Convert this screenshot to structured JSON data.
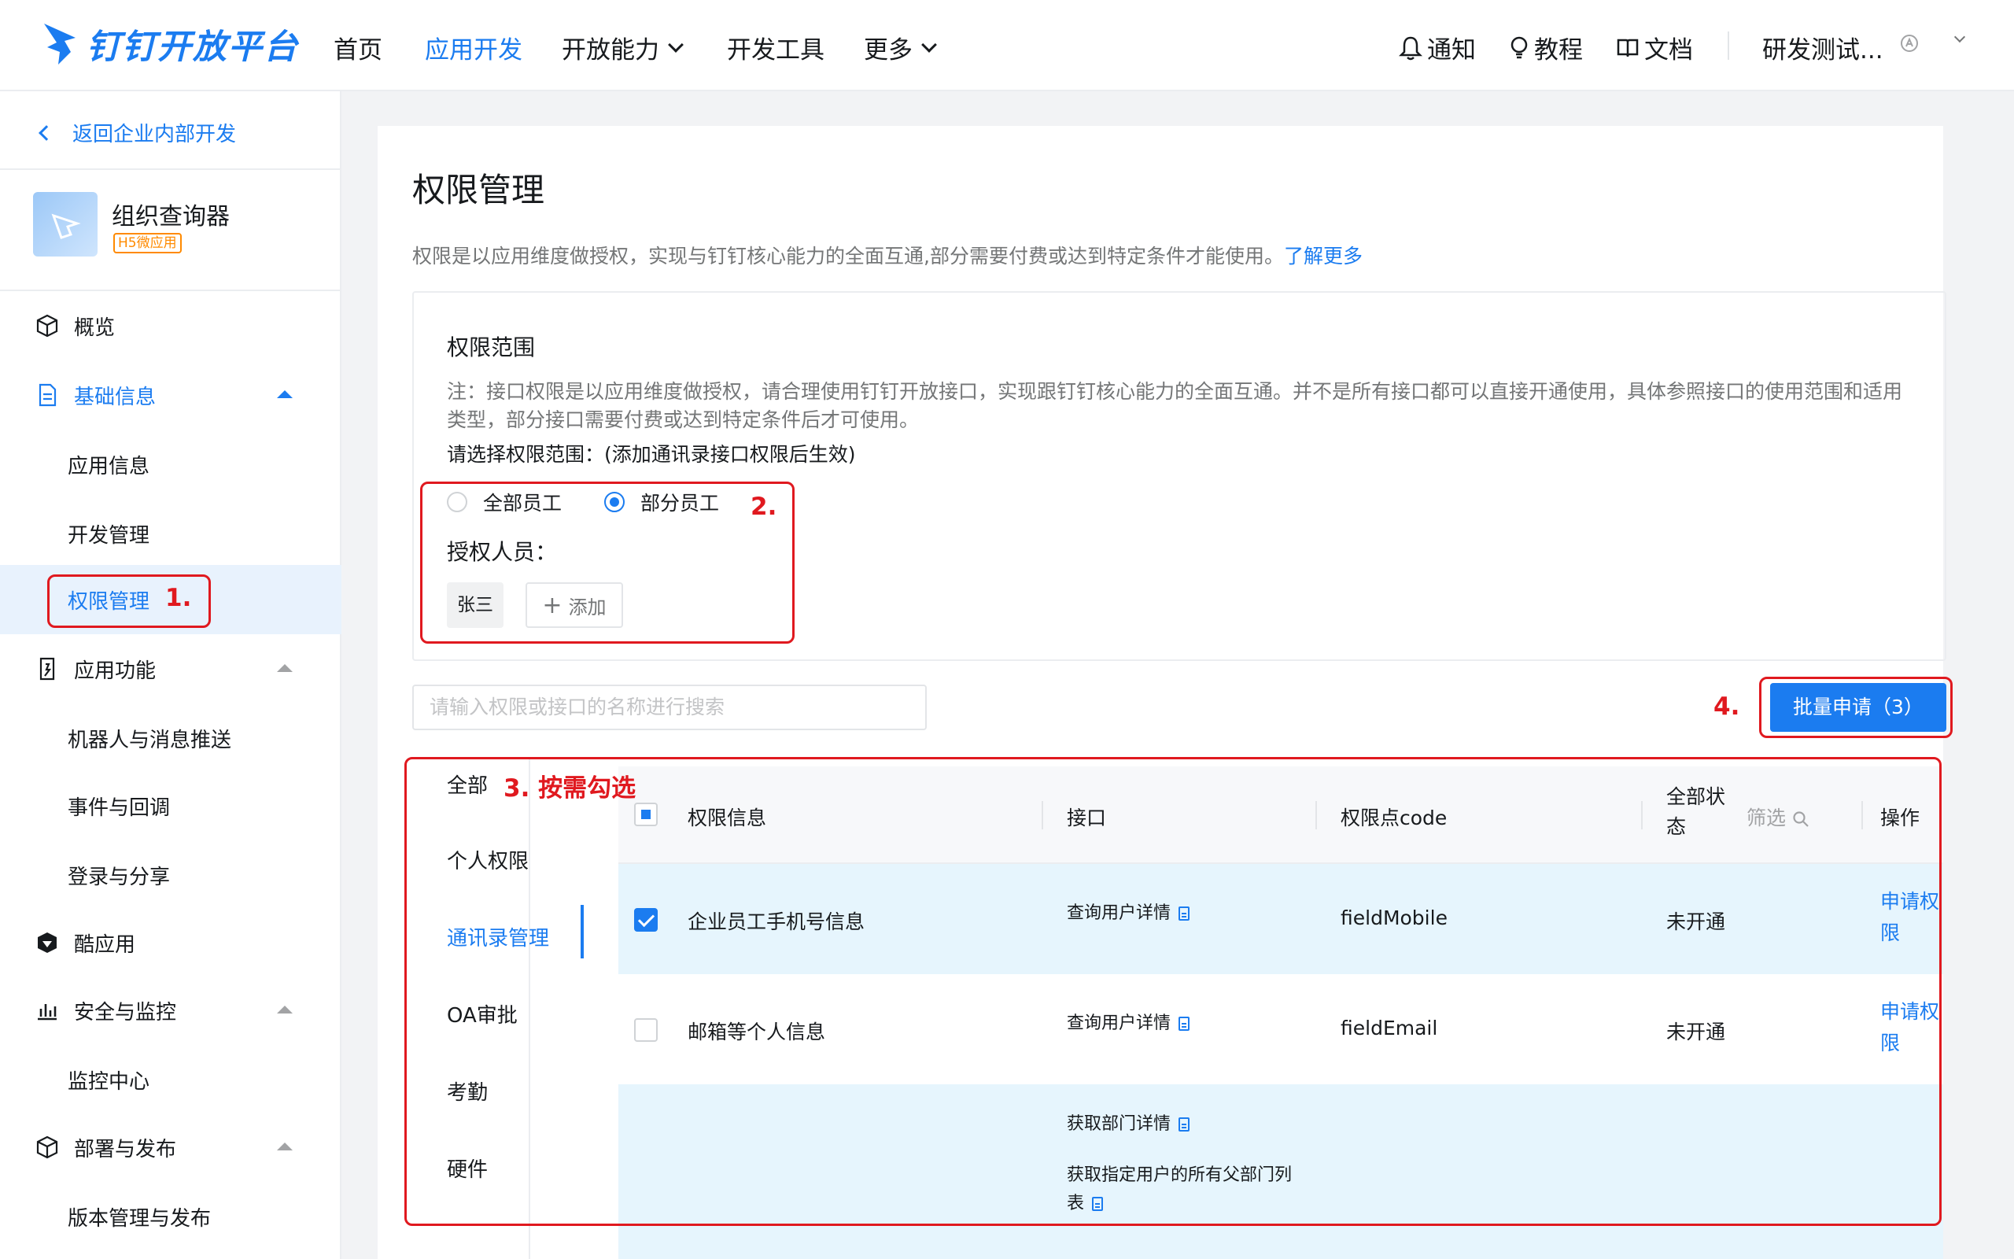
{
  "header": {
    "brand": "钉钉开放平台",
    "nav": [
      {
        "label": "首页"
      },
      {
        "label": "应用开发"
      },
      {
        "label": "开放能力"
      },
      {
        "label": "开发工具"
      },
      {
        "label": "更多"
      }
    ],
    "right": {
      "notify": "通知",
      "tutorial": "教程",
      "docs": "文档",
      "org": "研发测试..."
    }
  },
  "sidebar": {
    "back": "返回企业内部开发",
    "app_name": "组织查询器",
    "app_badge": "H5微应用",
    "menu": [
      {
        "label": "概览"
      },
      {
        "label": "基础信息"
      },
      {
        "label": "应用信息"
      },
      {
        "label": "开发管理"
      },
      {
        "label": "权限管理"
      },
      {
        "label": "应用功能"
      },
      {
        "label": "机器人与消息推送"
      },
      {
        "label": "事件与回调"
      },
      {
        "label": "登录与分享"
      },
      {
        "label": "酷应用"
      },
      {
        "label": "安全与监控"
      },
      {
        "label": "监控中心"
      },
      {
        "label": "部署与发布"
      },
      {
        "label": "版本管理与发布"
      }
    ]
  },
  "main": {
    "title": "权限管理",
    "desc": "权限是以应用维度做授权，实现与钉钉核心能力的全面互通,部分需要付费或达到特定条件才能使用。",
    "learn_more": "了解更多",
    "scope": {
      "title": "权限范围",
      "note": "注：接口权限是以应用维度做授权，请合理使用钉钉开放接口，实现跟钉钉核心能力的全面互通。并不是所有接口都可以直接开通使用，具体参照接口的使用范围和适用类型，部分接口需要付费或达到特定条件后才可使用。",
      "ask": "请选择权限范围：(添加通讯录接口权限后生效)",
      "option_all": "全部员工",
      "option_part": "部分员工",
      "auth_label": "授权人员：",
      "tag": "张三",
      "add": "添加"
    },
    "search_placeholder": "请输入权限或接口的名称进行搜索",
    "batch_button": "批量申请（3）",
    "categories": [
      {
        "label": "全部"
      },
      {
        "label": "个人权限"
      },
      {
        "label": "通讯录管理"
      },
      {
        "label": "OA审批"
      },
      {
        "label": "考勤"
      },
      {
        "label": "硬件"
      }
    ],
    "table": {
      "columns": {
        "info": "权限信息",
        "api": "接口",
        "code": "权限点code",
        "status": "全部状态",
        "filter": "筛选",
        "action": "操作"
      },
      "rows": [
        {
          "info": "企业员工手机号信息",
          "api": "查询用户详情",
          "code": "fieldMobile",
          "status": "未开通",
          "action": "申请权限"
        },
        {
          "info": "邮箱等个人信息",
          "api": "查询用户详情",
          "code": "fieldEmail",
          "status": "未开通",
          "action": "申请权限"
        },
        {
          "api1": "获取部门详情",
          "api2": "获取指定用户的所有父部门列表"
        }
      ]
    }
  },
  "annotations": {
    "a1": "1.",
    "a2": "2.",
    "a3": "3. 按需勾选",
    "a4": "4."
  },
  "colors": {
    "accent": "#1b7cf0",
    "annotation": "#e0191f",
    "selected_bg": "#e8f2fd",
    "row_highlight": "#e6f5fd"
  }
}
